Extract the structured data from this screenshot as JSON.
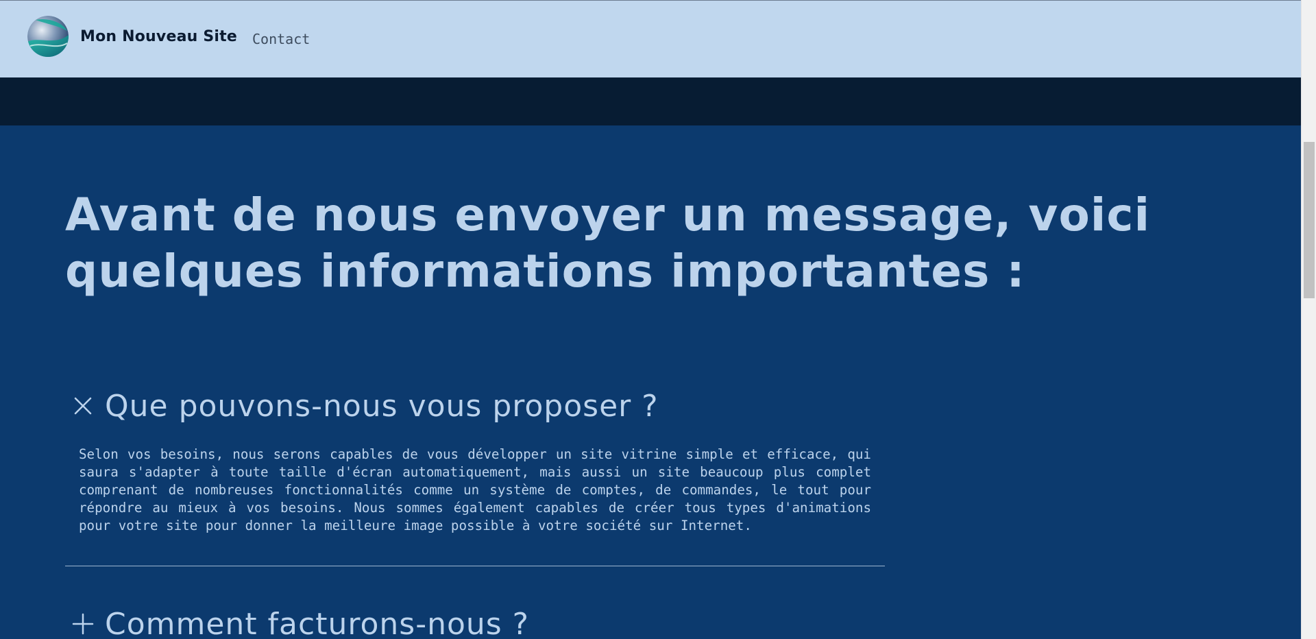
{
  "header": {
    "site_name": "Mon Nouveau Site",
    "nav": [
      {
        "label": "Contact"
      }
    ]
  },
  "main": {
    "heading": "Avant de nous envoyer un message, voici quelques informations importantes :",
    "faq": [
      {
        "question": "Que pouvons-nous vous proposer ?",
        "expanded": true,
        "toggle_icon": "close-icon",
        "answer": "Selon vos besoins, nous serons capables de vous développer un site vitrine simple et efficace, qui saura s'adapter à toute taille d'écran automatiquement, mais aussi un site beaucoup plus complet comprenant de nombreuses fonctionnalités comme un système de comptes, de commandes, le tout pour répondre au mieux à vos besoins. Nous sommes également capables de créer tous types d'animations pour votre site pour donner la meilleure image possible à votre société sur Internet."
      },
      {
        "question": "Comment facturons-nous ?",
        "expanded": false,
        "toggle_icon": "plus-icon"
      }
    ]
  },
  "colors": {
    "header_bg": "#c0d7ee",
    "dark_band": "#071c33",
    "main_bg": "#0c3a6e",
    "text_light": "#bcd3ec"
  }
}
